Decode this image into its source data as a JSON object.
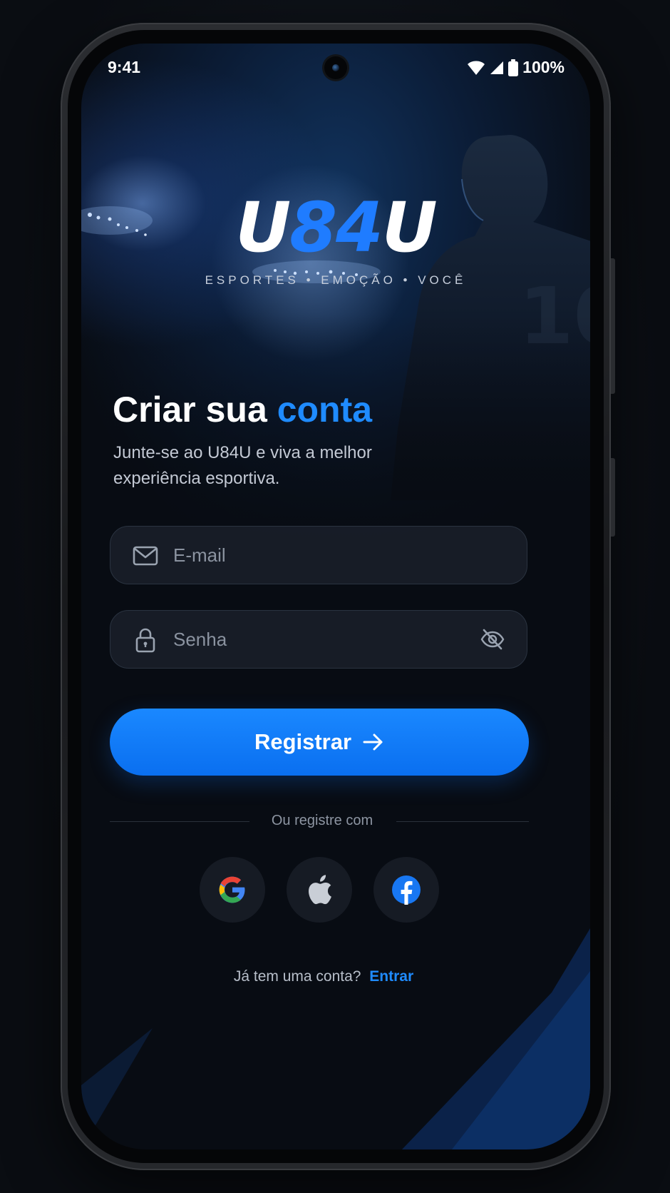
{
  "status_bar": {
    "time": "9:41",
    "battery": "100%",
    "icons": [
      "wifi-icon",
      "signal-icon",
      "battery-icon"
    ]
  },
  "brand": {
    "logo_part1": "U",
    "logo_accent": "84",
    "logo_part2": "U",
    "tagline": "ESPORTES • EMOÇÃO • VOCÊ"
  },
  "header": {
    "title_main": "Criar sua",
    "title_accent": "conta",
    "subtitle": "Junte-se ao U84U e viva a melhor experiência esportiva."
  },
  "form": {
    "email": {
      "placeholder": "E-mail",
      "value": "",
      "icon": "mail-icon"
    },
    "password": {
      "placeholder": "Senha",
      "value": "",
      "icon": "lock-icon",
      "toggle_icon": "eye-off-icon"
    },
    "submit_label": "Registrar",
    "submit_icon": "arrow-right-icon"
  },
  "social": {
    "divider_text": "Ou registre com",
    "providers": [
      "google-icon",
      "apple-icon",
      "facebook-icon"
    ]
  },
  "footer": {
    "prompt": "Já tem uma conta?",
    "link": "Entrar"
  },
  "colors": {
    "accent": "#1f8bff",
    "button": "#0a78ff",
    "background": "#080c13",
    "field": "#1a202a"
  }
}
